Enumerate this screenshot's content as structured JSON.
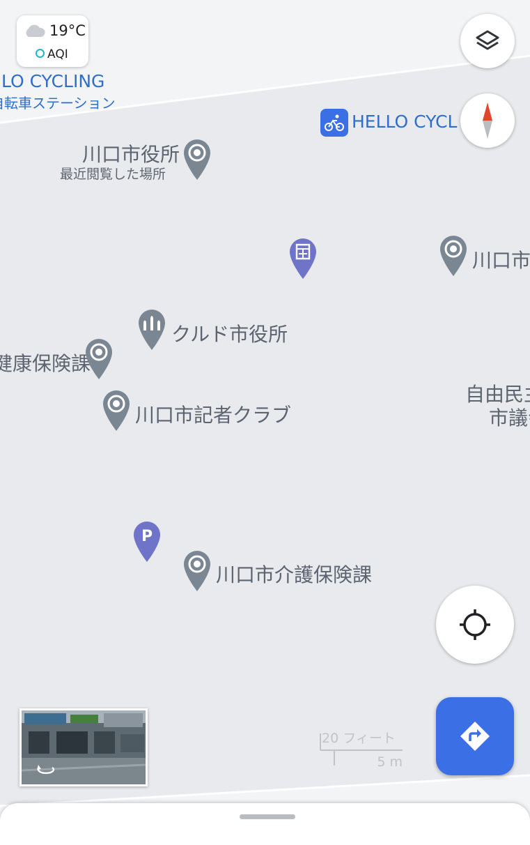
{
  "weather": {
    "temperature": "19°C",
    "aqi_label": "AQI",
    "icon": "cloud-icon"
  },
  "map": {
    "labels": {
      "hello_cycling_left": "LO CYCLING",
      "bicycle_station": "自転車ステーション",
      "hello_cycling_right": "HELLO CYCL",
      "city_hall": "川口市役所",
      "recently_viewed": "最近閲覧した場所",
      "kawaguchi_right": "川口市",
      "kurdish_city_hall": "クルド市役所",
      "health_insurance": "健康保険課",
      "press_club": "川口市記者クラブ",
      "ldp_line1": "自由民主",
      "ldp_line2": "市議会",
      "care_insurance": "川口市介護保険課"
    }
  },
  "scale": {
    "feet": "20 フィート",
    "meters": "5 m"
  },
  "controls": {
    "layers": "layers-icon",
    "compass": "compass-icon",
    "location": "my-location-icon",
    "directions": "directions-icon"
  },
  "colors": {
    "accent": "#3b6fe5",
    "pin": "#7a8793",
    "pin_purple": "#6f74c9",
    "label_blue": "#2f6ecb"
  }
}
